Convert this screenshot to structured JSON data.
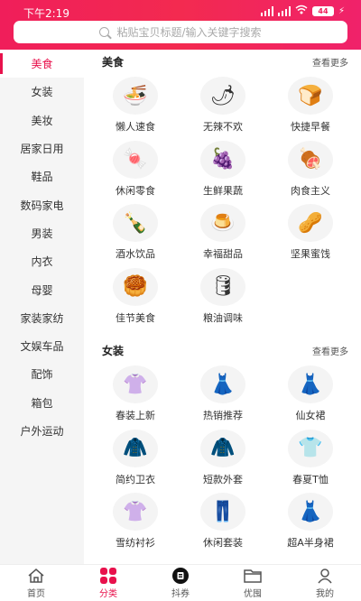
{
  "status": {
    "time": "下午2:19",
    "battery": "44"
  },
  "search": {
    "placeholder": "粘贴宝贝标题/输入关键字搜索"
  },
  "sidebar": {
    "items": [
      {
        "label": "美食"
      },
      {
        "label": "女装"
      },
      {
        "label": "美妆"
      },
      {
        "label": "居家日用"
      },
      {
        "label": "鞋品"
      },
      {
        "label": "数码家电"
      },
      {
        "label": "男装"
      },
      {
        "label": "内衣"
      },
      {
        "label": "母婴"
      },
      {
        "label": "家装家纺"
      },
      {
        "label": "文娱车品"
      },
      {
        "label": "配饰"
      },
      {
        "label": "箱包"
      },
      {
        "label": "户外运动"
      }
    ]
  },
  "sections": [
    {
      "title": "美食",
      "more": "查看更多",
      "items": [
        {
          "label": "懒人速食",
          "icon": "instant-noodle-icon",
          "glyph": "🍜"
        },
        {
          "label": "无辣不欢",
          "icon": "spicy-snack-icon",
          "glyph": "🌶"
        },
        {
          "label": "快捷早餐",
          "icon": "bread-icon",
          "glyph": "🍞"
        },
        {
          "label": "休闲零食",
          "icon": "snack-bag-icon",
          "glyph": "🍬"
        },
        {
          "label": "生鲜果蔬",
          "icon": "fruit-icon",
          "glyph": "🍇"
        },
        {
          "label": "肉食主义",
          "icon": "meat-icon",
          "glyph": "🍖"
        },
        {
          "label": "酒水饮品",
          "icon": "drinks-icon",
          "glyph": "🍾"
        },
        {
          "label": "幸福甜品",
          "icon": "dessert-icon",
          "glyph": "🍮"
        },
        {
          "label": "坚果蜜饯",
          "icon": "nuts-icon",
          "glyph": "🥜"
        },
        {
          "label": "佳节美食",
          "icon": "mooncake-icon",
          "glyph": "🥮"
        },
        {
          "label": "粮油调味",
          "icon": "rice-oil-icon",
          "glyph": "🛢"
        }
      ]
    },
    {
      "title": "女装",
      "more": "查看更多",
      "items": [
        {
          "label": "春装上新",
          "icon": "blouse-icon",
          "glyph": "👚"
        },
        {
          "label": "热销推荐",
          "icon": "dress-icon",
          "glyph": "👗"
        },
        {
          "label": "仙女裙",
          "icon": "fairy-dress-icon",
          "glyph": "👗"
        },
        {
          "label": "简约卫衣",
          "icon": "hoodie-icon",
          "glyph": "🧥"
        },
        {
          "label": "短款外套",
          "icon": "jacket-icon",
          "glyph": "🧥"
        },
        {
          "label": "春夏T恤",
          "icon": "tshirt-icon",
          "glyph": "👕"
        },
        {
          "label": "雪纺衬衫",
          "icon": "chiffon-shirt-icon",
          "glyph": "👚"
        },
        {
          "label": "休闲套装",
          "icon": "casual-set-icon",
          "glyph": "👖"
        },
        {
          "label": "超A半身裙",
          "icon": "skirt-icon",
          "glyph": "👗"
        }
      ]
    }
  ],
  "tabs": [
    {
      "label": "首页",
      "icon": "home-icon"
    },
    {
      "label": "分类",
      "icon": "category-icon"
    },
    {
      "label": "抖券",
      "icon": "coupon-icon"
    },
    {
      "label": "优囤",
      "icon": "folder-icon"
    },
    {
      "label": "我的",
      "icon": "profile-icon"
    }
  ],
  "colors": {
    "accent": "#e8114c",
    "sidebar_bg": "#f5f5f5"
  }
}
